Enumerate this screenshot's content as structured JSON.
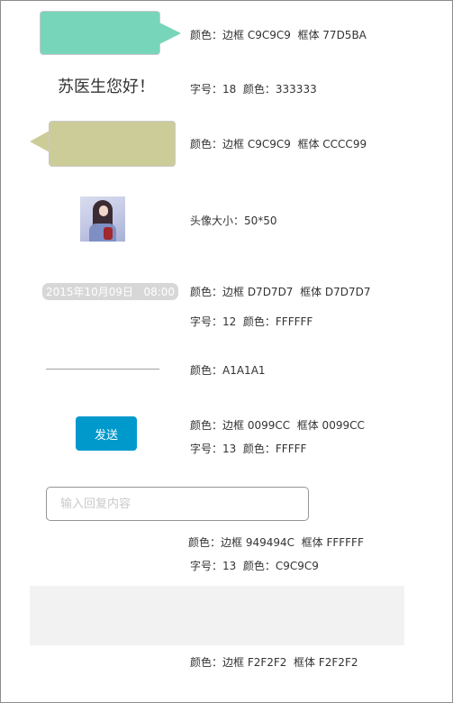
{
  "bubble_green": {
    "label": "颜色：边框 C9C9C9  框体 77D5BA",
    "border": "#C9C9C9",
    "fill": "#77D5BA"
  },
  "greeting": {
    "text": "苏医生您好！",
    "label": "字号：18  颜色：333333",
    "color": "#333333"
  },
  "bubble_olive": {
    "label": "颜色：边框 C9C9C9  框体 CCCC99",
    "border": "#C9C9C9",
    "fill": "#CCCC99"
  },
  "avatar": {
    "label": "头像大小：50*50"
  },
  "time_pill": {
    "text": "2015年10月09日   08:00",
    "label_color": "颜色：边框 D7D7D7  框体 D7D7D7",
    "label_font": "字号：12  颜色：FFFFFF",
    "fill": "#D7D7D7",
    "text_color": "#FFFFFF"
  },
  "divider": {
    "label": "颜色：A1A1A1",
    "color": "#A1A1A1"
  },
  "send_button": {
    "text": "发送",
    "label_color": "颜色：边框 0099CC  框体 0099CC",
    "label_font": "字号：13  颜色：FFFFF",
    "fill": "#0099CC",
    "text_color": "#FFFFFF"
  },
  "reply_input": {
    "placeholder": "输入回复内容",
    "label_color": "颜色：边框 949494C  框体 FFFFFF",
    "label_font": "字号：13  颜色：C9C9C9",
    "border": "#949494",
    "placeholder_color": "#C9C9C9"
  },
  "gray_panel": {
    "label": "颜色：边框 F2F2F2  框体 F2F2F2",
    "fill": "#F2F2F2"
  }
}
